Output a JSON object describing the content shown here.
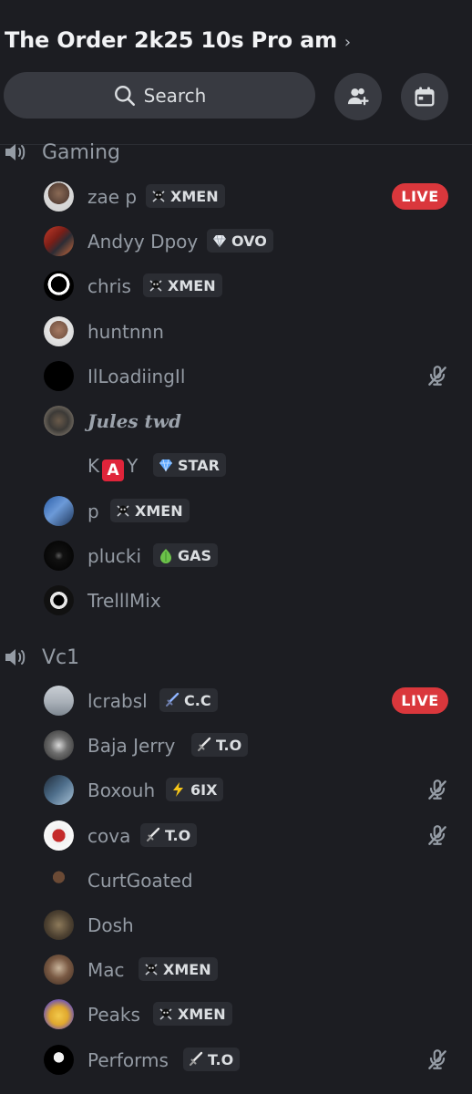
{
  "header": {
    "server_name": "The Order 2k25 10s Pro am",
    "chevron": "›",
    "search_label": "Search",
    "add_member_icon": "add-member-icon",
    "events_icon": "calendar-icon"
  },
  "colors": {
    "background": "#1c1d22",
    "surface": "#383a41",
    "live": "#da373c",
    "muted_text": "#949ba4"
  },
  "channels": [
    {
      "name": "Gaming",
      "members": [
        {
          "name": "zae p",
          "tag": {
            "icon": "skull-icon",
            "text": "XMEN"
          },
          "live": "LIVE"
        },
        {
          "name": "Andyy Dpoy",
          "tag": {
            "icon": "diamond-icon",
            "text": "OVO"
          }
        },
        {
          "name": "chris",
          "tag": {
            "icon": "skull-icon",
            "text": "XMEN"
          }
        },
        {
          "name": "huntnnn"
        },
        {
          "name": "IlLoadiingIl",
          "muted": true
        },
        {
          "name": "Jules twd"
        },
        {
          "name_prefix": "K",
          "name_key": "A",
          "name_suffix": "Y",
          "tag": {
            "icon": "gem-icon",
            "text": "STAR"
          }
        },
        {
          "name": "p",
          "tag": {
            "icon": "skull-icon",
            "text": "XMEN"
          }
        },
        {
          "name": "plucki",
          "tag": {
            "icon": "leaf-icon",
            "text": "GAS"
          }
        },
        {
          "name": "TrelllMix"
        }
      ]
    },
    {
      "name": "Vc1",
      "members": [
        {
          "name": "lcrabsl",
          "tag": {
            "icon": "sword-icon",
            "text": "C.C"
          },
          "live": "LIVE"
        },
        {
          "name": "Baja Jerry",
          "tag": {
            "icon": "sword-icon",
            "text": "T.O"
          }
        },
        {
          "name": "Boxouh",
          "tag": {
            "icon": "lightning-icon",
            "text": "6IX"
          },
          "muted": true
        },
        {
          "name": "cova",
          "tag": {
            "icon": "sword-icon",
            "text": "T.O"
          },
          "muted": true
        },
        {
          "name": "CurtGoated"
        },
        {
          "name": "Dosh"
        },
        {
          "name": "Mac",
          "tag": {
            "icon": "skull-icon",
            "text": "XMEN"
          }
        },
        {
          "name": "Peaks",
          "tag": {
            "icon": "skull-icon",
            "text": "XMEN"
          }
        },
        {
          "name": "Performs",
          "tag": {
            "icon": "sword-icon",
            "text": "T.O"
          },
          "muted": true
        }
      ]
    }
  ]
}
